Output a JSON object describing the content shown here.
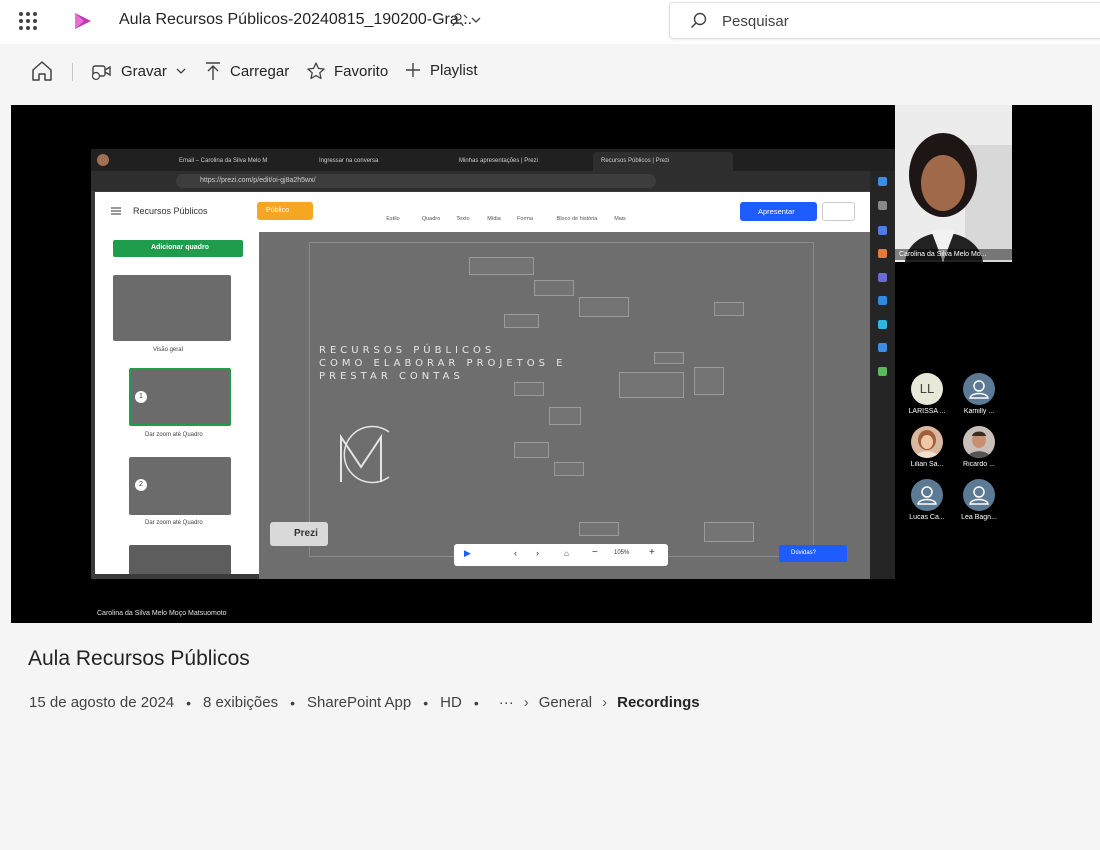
{
  "header": {
    "title": "Aula Recursos Públicos-20240815_190200-Gra...",
    "search_placeholder": "Pesquisar"
  },
  "toolbar": {
    "record": "Gravar",
    "upload": "Carregar",
    "favorite": "Favorito",
    "playlist": "Playlist"
  },
  "screen": {
    "tabs": [
      "Email – Carolina da Silva Melo M",
      "Ingressar na conversa",
      "Minhas apresentações | Prezi",
      "Recursos Públicos | Prezi"
    ],
    "url": "https://prezi.com/p/edit/oi-gj8a2h5wx/",
    "prezi_title": "Recursos Públicos",
    "publico": "Público",
    "tools": [
      "Estilo",
      "Quadro",
      "Texto",
      "Mídia",
      "Forma",
      "Bloco de história",
      "Mais"
    ],
    "apresentar": "Apresentar",
    "add_frame": "Adicionar quadro",
    "overview": "Visão geral",
    "zoom1": "Dar zoom até Quadro",
    "zoom2": "Dar zoom até Quadro",
    "step1": "1",
    "step2": "2",
    "pres_line1": "RECURSOS PÚBLICOS",
    "pres_line2": "COMO ELABORAR PROJETOS E",
    "pres_line3": "PRESTAR CONTAS",
    "prezi_badge": "Prezi",
    "zoom_level": "105%",
    "duvidas": "Dúvidas?"
  },
  "camera_name": "Carolina da Silva Melo Mo...",
  "participants": [
    {
      "initials": "LL",
      "name": "LARISSA ..."
    },
    {
      "initials": "",
      "name": "Kamilly ..."
    },
    {
      "initials": "",
      "name": "Lilian Sa..."
    },
    {
      "initials": "",
      "name": "Ricardo ..."
    },
    {
      "initials": "",
      "name": "Lucas Ca..."
    },
    {
      "initials": "",
      "name": "Lea Bagn..."
    }
  ],
  "presenter_label": "Carolina da Silva Melo Moço Matsuomoto",
  "video_title": "Aula Recursos Públicos",
  "meta": {
    "date": "15 de agosto de 2024",
    "views": "8 exibições",
    "app": "SharePoint App",
    "quality": "HD",
    "more": "···",
    "crumb1": "General",
    "crumb2": "Recordings"
  },
  "colors": {
    "accent": "#1f5cff",
    "brand": "#c239b3"
  }
}
